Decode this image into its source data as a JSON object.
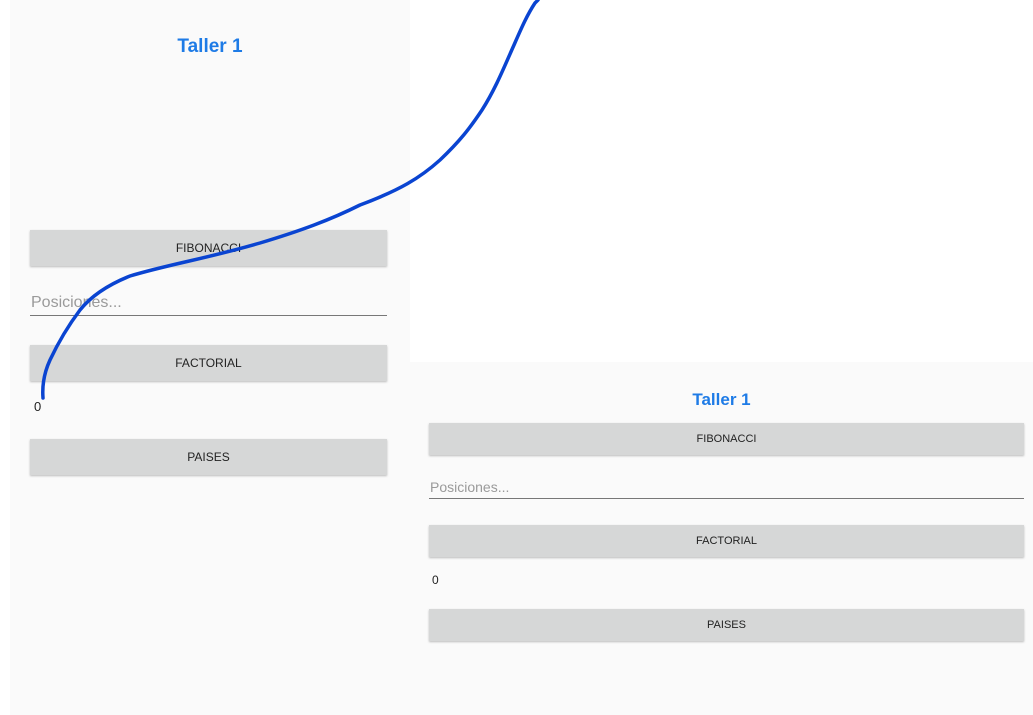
{
  "screens": [
    {
      "title": "Taller 1",
      "fibonacci_label": "FIBONACCI",
      "positions_placeholder": "Posiciones...",
      "factorial_label": "FACTORIAL",
      "result": "0",
      "paises_label": "PAISES"
    },
    {
      "title": "Taller 1",
      "fibonacci_label": "FIBONACCI",
      "positions_placeholder": "Posiciones...",
      "factorial_label": "FACTORIAL",
      "result": "0",
      "paises_label": "PAISES"
    }
  ],
  "colors": {
    "title_accent": "#1e7be6",
    "button_bg": "#d6d7d7",
    "screen_bg": "#fafafa",
    "annotation_stroke": "#0a44d1"
  },
  "annotation": {
    "icon": "freehand-stroke-icon"
  }
}
